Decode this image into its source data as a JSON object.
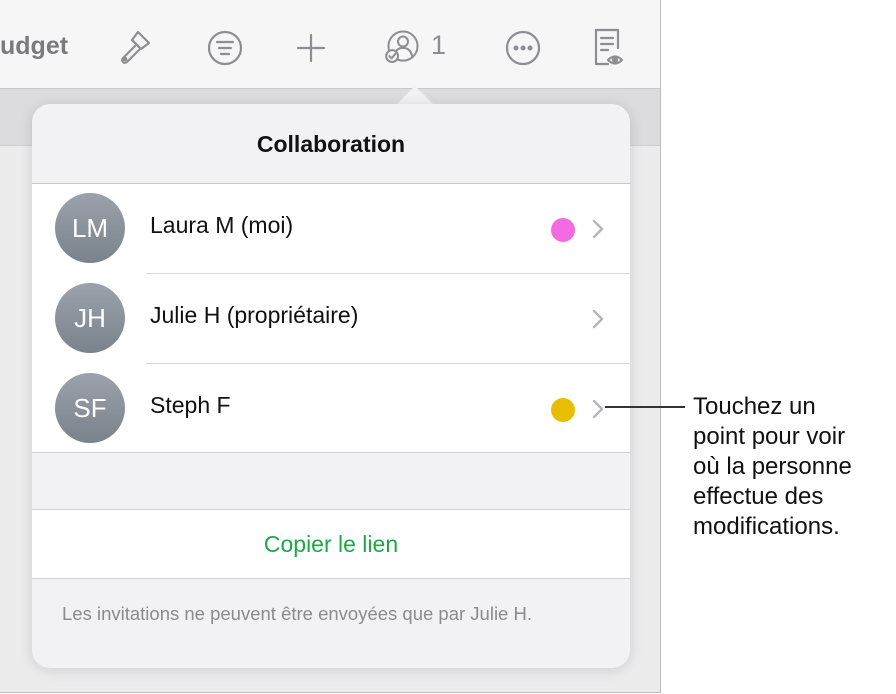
{
  "toolbar": {
    "title_fragment": "udget",
    "collaborator_count": "1",
    "icons": [
      "format-brush-icon",
      "filter-icon",
      "plus-icon",
      "collaboration-icon",
      "more-icon",
      "reader-view-icon"
    ]
  },
  "popover": {
    "title": "Collaboration",
    "people": [
      {
        "initials": "LM",
        "name": "Laura M (moi)",
        "dot_color": "#f36be3"
      },
      {
        "initials": "JH",
        "name": "Julie H (propriétaire)",
        "dot_color": null
      },
      {
        "initials": "SF",
        "name": "Steph F",
        "dot_color": "#e8bd00"
      }
    ],
    "copy_link_label": "Copier le lien",
    "footer_note": "Les invitations ne peuvent être envoyées que par Julie H."
  },
  "callout": {
    "lines": [
      "Touchez un",
      "point pour voir",
      "où la personne",
      "effectue des",
      "modifications."
    ]
  },
  "colors": {
    "accent_green": "#1fa84a",
    "avatar_gray": "#8a919a"
  }
}
